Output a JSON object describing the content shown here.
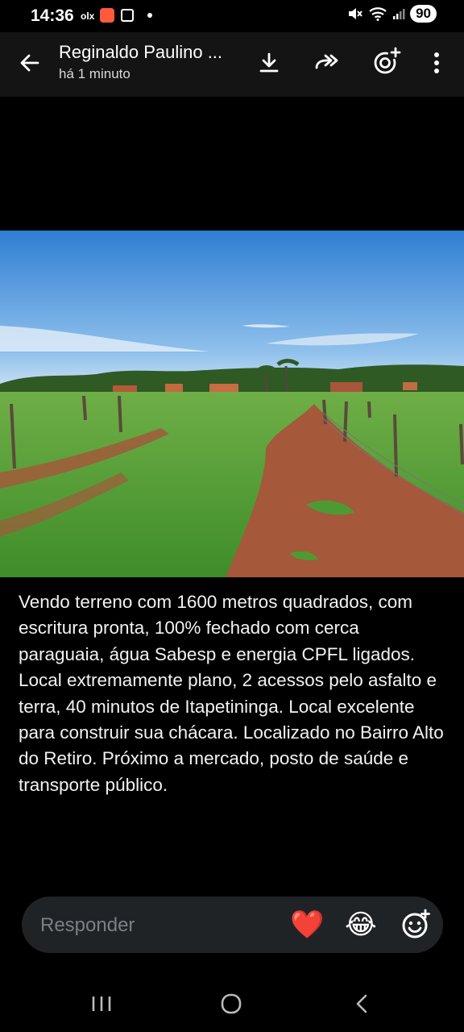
{
  "status_bar": {
    "time": "14:36",
    "app1": "olx",
    "battery": "90"
  },
  "header": {
    "title": "Reginaldo Paulino ...",
    "subtitle": "há 1 minuto",
    "icons": [
      "back-arrow-icon",
      "download-icon",
      "forward-icon",
      "add-status-icon",
      "more-vert-icon"
    ]
  },
  "caption": "Vendo terreno com 1600 metros quadrados, com escritura pronta, 100% fechado com cerca paraguaia, água Sabesp e energia CPFL ligados. Local extremamente plano, 2 acessos pelo asfalto e terra, 40 minutos de Itapetininga. Local excelente para construir sua chácara. Localizado no Bairro Alto do Retiro. Próximo a mercado, posto de saúde e transporte público.",
  "reply": {
    "placeholder": "Responder",
    "heart": "❤️",
    "laugh": "😂"
  },
  "colors": {
    "background": "#000000",
    "header": "#141414",
    "reply_bar": "#202326",
    "sky": "#3e88d6",
    "grass": "#4d9a33",
    "soil": "#a2563a"
  }
}
